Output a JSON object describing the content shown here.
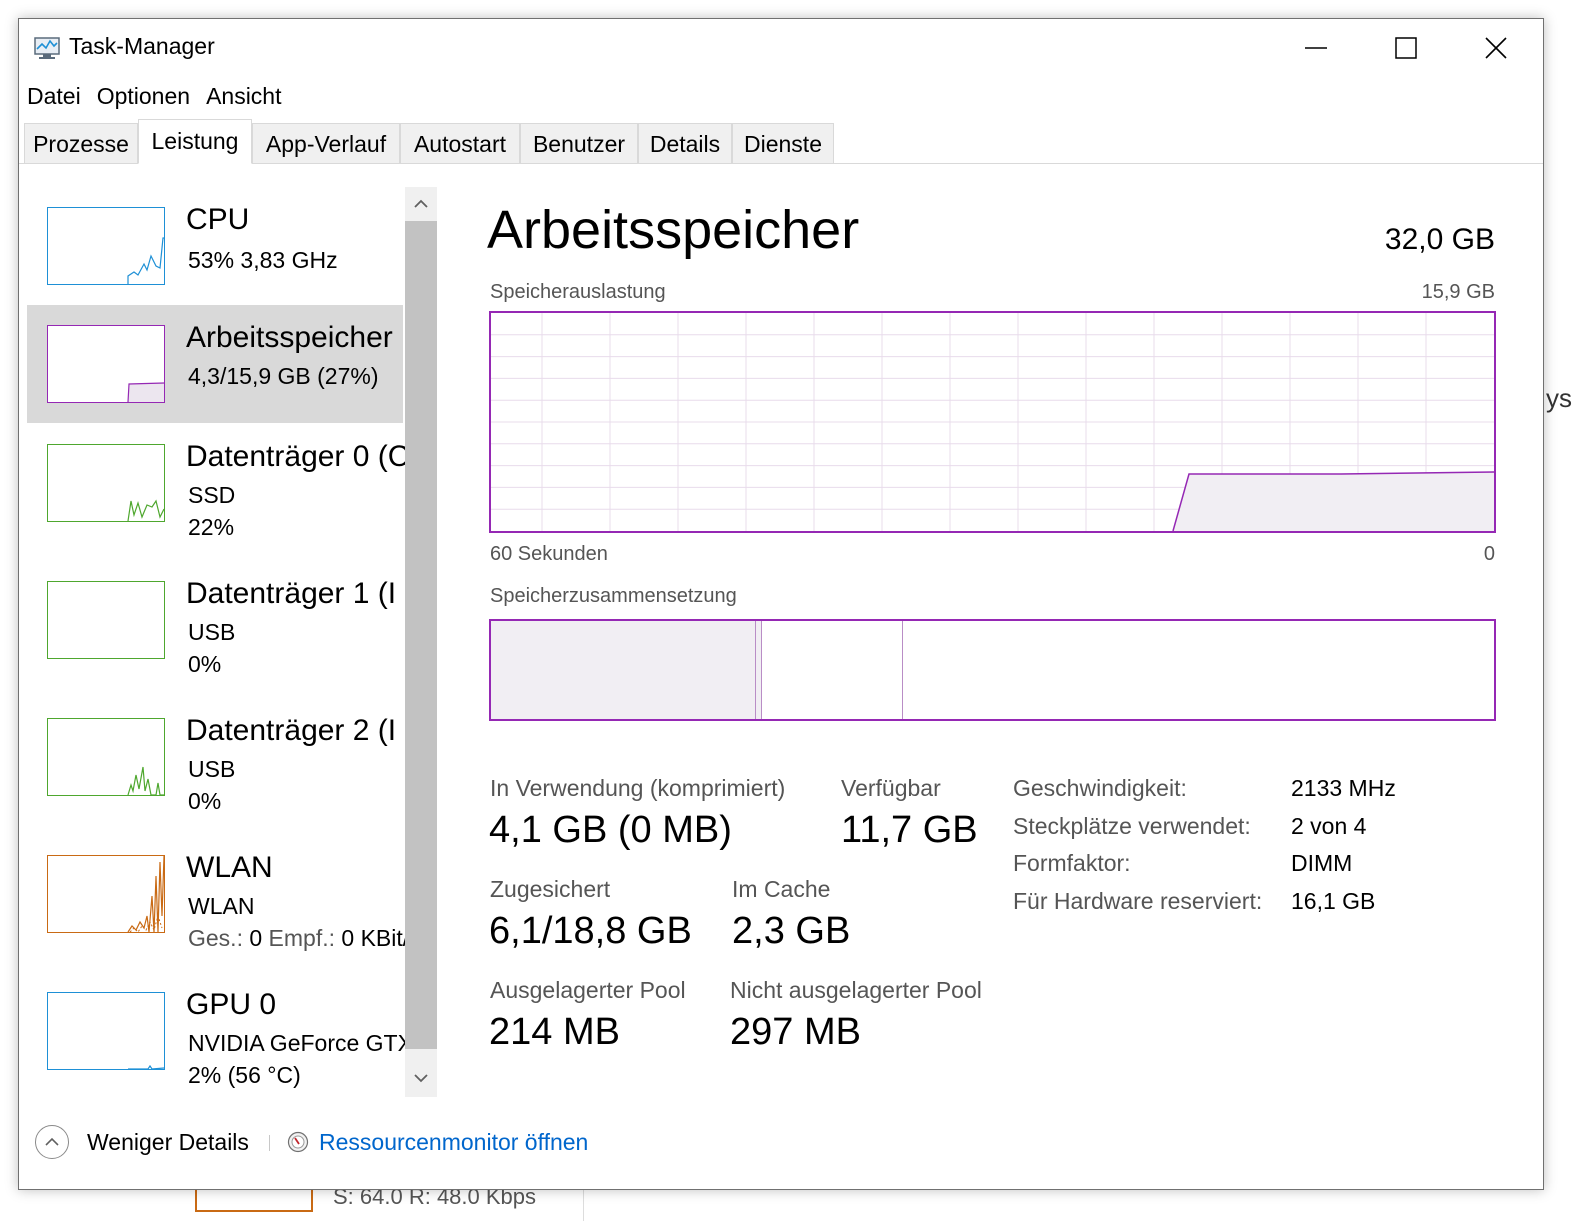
{
  "window": {
    "title": "Task-Manager",
    "app_icon": "task-manager-icon",
    "controls": [
      "minimize-icon",
      "maximize-icon",
      "close-icon"
    ]
  },
  "menu": [
    "Datei",
    "Optionen",
    "Ansicht"
  ],
  "tabs": [
    "Prozesse",
    "Leistung",
    "App-Verlauf",
    "Autostart",
    "Benutzer",
    "Details",
    "Dienste"
  ],
  "active_tab": "Leistung",
  "sidebar": {
    "items": [
      {
        "name": "CPU",
        "line1": "53%  3,83 GHz",
        "line2": "",
        "color": "#1e90d6"
      },
      {
        "name": "Arbeitsspeicher",
        "line1": "4,3/15,9 GB (27%)",
        "line2": "",
        "color": "#9528b4"
      },
      {
        "name": "Datenträger 0 (C",
        "line1": "SSD",
        "line2": "22%",
        "color": "#4ea72e"
      },
      {
        "name": "Datenträger 1 (I",
        "line1": "USB",
        "line2": "0%",
        "color": "#4ea72e"
      },
      {
        "name": "Datenträger 2 (I",
        "line1": "USB",
        "line2": "0%",
        "color": "#4ea72e"
      },
      {
        "name": "WLAN",
        "line1": "WLAN",
        "line2_label_a": "Ges.:",
        "line2_value_a": "0",
        "line2_label_b": "Empf.:",
        "line2_value_b": "0 KBit/",
        "color": "#c96a14"
      },
      {
        "name": "GPU 0",
        "line1": "NVIDIA GeForce GTX",
        "line2": "2%  (56 °C)",
        "color": "#1e90d6"
      }
    ]
  },
  "main": {
    "title": "Arbeitsspeicher",
    "total": "32,0 GB",
    "usage_label": "Speicherauslastung",
    "usage_max": "15,9 GB",
    "time_left": "60 Sekunden",
    "time_right": "0",
    "composition_label": "Speicherzusammensetzung",
    "stats": [
      {
        "label": "In Verwendung (komprimiert)",
        "value": "4,1 GB (0 MB)"
      },
      {
        "label": "Verfügbar",
        "value": "11,7 GB"
      },
      {
        "label": "Zugesichert",
        "value": "6,1/18,8 GB"
      },
      {
        "label": "Im Cache",
        "value": "2,3 GB"
      },
      {
        "label": "Ausgelagerter Pool",
        "value": "214 MB"
      },
      {
        "label": "Nicht ausgelagerter Pool",
        "value": "297 MB"
      }
    ],
    "properties": [
      {
        "label": "Geschwindigkeit:",
        "value": "2133 MHz"
      },
      {
        "label": "Steckplätze verwendet:",
        "value": "2 von 4"
      },
      {
        "label": "Formfaktor:",
        "value": "DIMM"
      },
      {
        "label": "Für Hardware reserviert:",
        "value": "16,1 GB"
      }
    ]
  },
  "footer": {
    "less_details": "Weniger Details",
    "resource_monitor": "Ressourcenmonitor öffnen"
  },
  "background_peek": {
    "text": "S: 64.0  R: 48.0 Kbps",
    "side_text": "ys"
  },
  "colors": {
    "memory": "#9528b4",
    "cpu": "#1e90d6",
    "disk": "#4ea72e",
    "wlan": "#c96a14",
    "link": "#0066cc"
  }
}
